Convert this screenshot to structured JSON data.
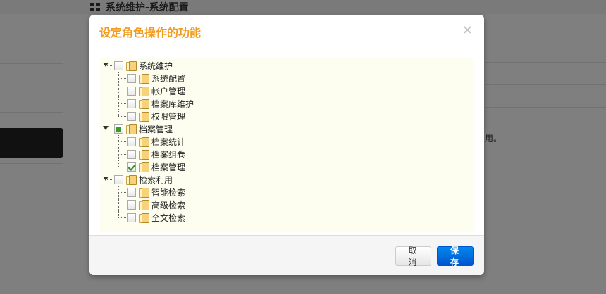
{
  "background": {
    "page_title": "系统维护-系统配置",
    "right_text": "用。"
  },
  "modal": {
    "title": "设定角色操作的功能",
    "close_symbol": "×",
    "tree": [
      {
        "label": "系统维护",
        "state": "unchecked",
        "children": [
          {
            "label": "系统配置",
            "state": "unchecked"
          },
          {
            "label": "帐户管理",
            "state": "unchecked"
          },
          {
            "label": "档案库维护",
            "state": "unchecked"
          },
          {
            "label": "权限管理",
            "state": "unchecked"
          }
        ]
      },
      {
        "label": "档案管理",
        "state": "partial",
        "children": [
          {
            "label": "档案统计",
            "state": "unchecked"
          },
          {
            "label": "档案组卷",
            "state": "unchecked"
          },
          {
            "label": "档案管理",
            "state": "checked"
          }
        ]
      },
      {
        "label": "检索利用",
        "state": "unchecked",
        "children": [
          {
            "label": "智能检索",
            "state": "unchecked"
          },
          {
            "label": "高级检索",
            "state": "unchecked"
          },
          {
            "label": "全文检索",
            "state": "unchecked"
          }
        ]
      }
    ],
    "footer": {
      "cancel_label": "取消",
      "save_label": "保存"
    }
  },
  "colors": {
    "title": "#f29c1f",
    "primary": "#0066dd",
    "tree_bg": "#fefef0"
  }
}
